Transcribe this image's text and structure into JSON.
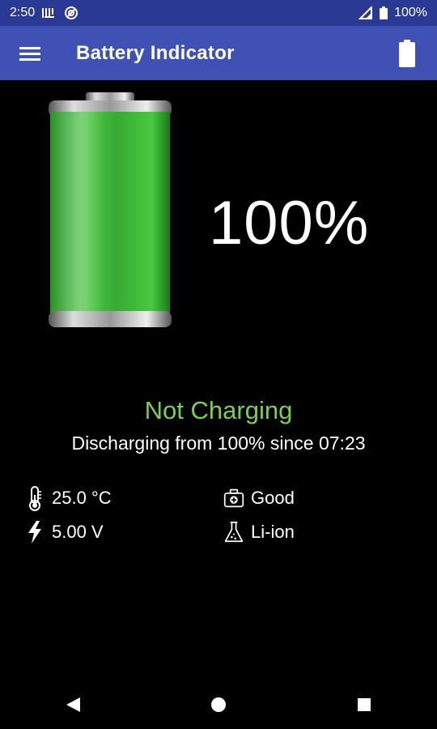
{
  "status_bar": {
    "time": "2:50",
    "battery_text": "100%"
  },
  "app_bar": {
    "title": "Battery Indicator",
    "menu_icon": "menu-icon",
    "action_icon": "battery-icon"
  },
  "battery": {
    "level_fraction": 1.0,
    "percent_label": "100%",
    "fill_color": "#2fa82a"
  },
  "status": {
    "title": "Not Charging",
    "subtitle": "Discharging from 100% since 07:23",
    "title_color": "#7bd14d"
  },
  "info": {
    "temperature": "25.0 °C",
    "voltage": "5.00 V",
    "health": "Good",
    "technology": "Li-ion"
  },
  "colors": {
    "app_bar": "#3f51b5",
    "status_bar": "#2a3a94"
  }
}
